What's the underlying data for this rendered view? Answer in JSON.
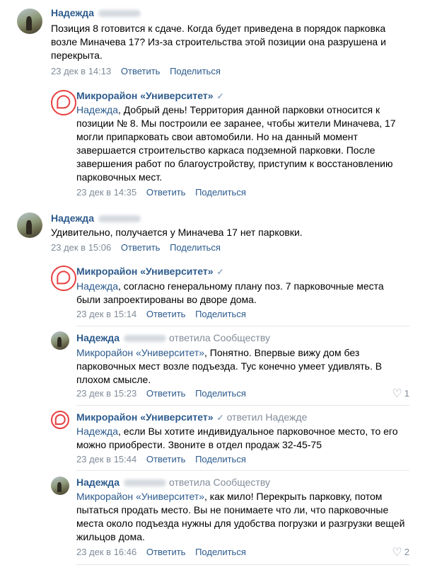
{
  "comments": [
    {
      "author": "Надежда",
      "text": "Позиция 8 готовится к сдаче. Когда будет приведена в порядок парковка возле Миначева 17? Из-за строительства этой позиции она разрушена и перекрыта.",
      "date": "23 дек в 14:13",
      "reply_label": "Ответить",
      "share_label": "Поделиться"
    },
    {
      "author": "Микрорайон «Университет»",
      "mention": "Надежда",
      "text": ", Добрый день! Территория данной парковки относится к позиции № 8. Мы построили ее заранее, чтобы жители Миначева, 17 могли припарковать свои автомобили. Но на данный момент завершается строительство каркаса подземной парковки. После завершения работ по благоустройству, приступим к восстановлению парковочных мест.",
      "date": "23 дек в 14:35",
      "reply_label": "Ответить",
      "share_label": "Поделиться"
    },
    {
      "author": "Надежда",
      "text": "Удивительно, получается у Миначева 17 нет парковки.",
      "date": "23 дек в 15:06",
      "reply_label": "Ответить",
      "share_label": "Поделиться"
    },
    {
      "author": "Микрорайон «Университет»",
      "mention": "Надежда",
      "text": ", согласно генеральному плану поз. 7 парковочные места были запроектированы во дворе дома.",
      "date": "23 дек в 15:14",
      "reply_label": "Ответить",
      "share_label": "Поделиться"
    },
    {
      "author": "Надежда",
      "reply_to": "ответила Сообществу",
      "mention": "Микрорайон «Университет»",
      "text": ", Понятно. Впервые вижу дом без парковочных мест возле подъезда. Тус конечно умеет удивлять. В плохом смысле.",
      "date": "23 дек в 15:23",
      "reply_label": "Ответить",
      "share_label": "Поделиться",
      "likes": "1"
    },
    {
      "author": "Микрорайон «Университет»",
      "reply_to": "ответил Надежде",
      "mention": "Надежда",
      "text": ", если Вы хотите индивидуальное парковочное место, то его можно приобрести. Звоните в отдел продаж 32-45-75",
      "date": "23 дек в 15:44",
      "reply_label": "Ответить",
      "share_label": "Поделиться"
    },
    {
      "author": "Надежда",
      "reply_to": "ответила Сообществу",
      "mention": "Микрорайон «Университет»",
      "text": ", как мило! Перекрыть парковку, потом пытаться продать место. Вы не понимаете что ли, что парковочные места около подъезда нужны для удобства погрузки и разгрузки вещей жильцов дома.",
      "date": "23 дек в 16:46",
      "reply_label": "Ответить",
      "share_label": "Поделиться",
      "likes": "2"
    }
  ],
  "colors": {
    "link": "#2c5a8c",
    "meta": "#818c99",
    "brand": "#e6403f"
  },
  "icons": {
    "verified": "✓",
    "like": "♡"
  }
}
